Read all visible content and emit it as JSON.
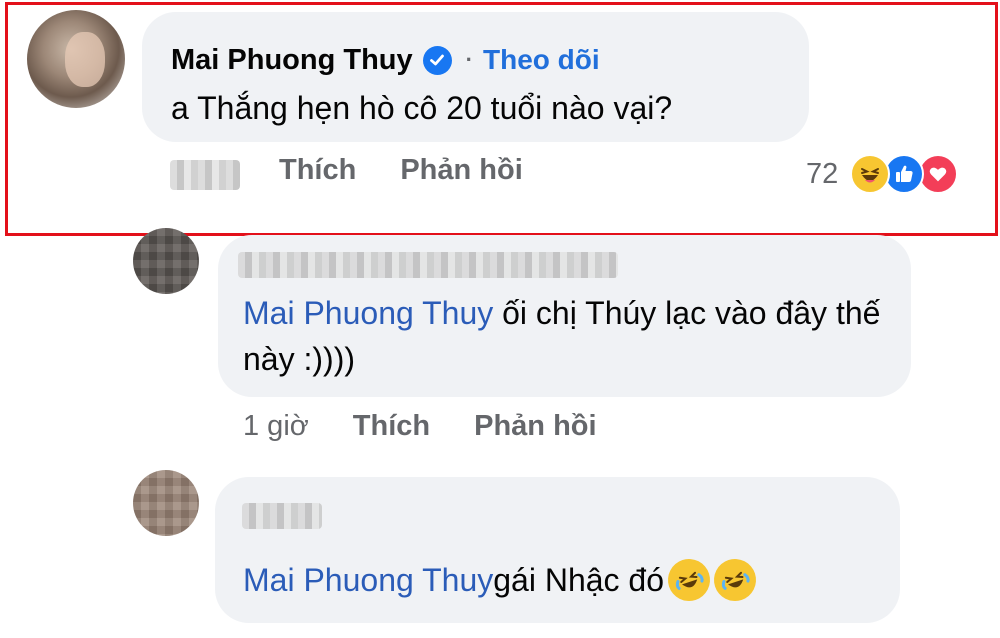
{
  "main_comment": {
    "author": "Mai Phuong Thuy",
    "separator": "·",
    "follow_label": "Theo dõi",
    "text": "a Thắng hẹn hò cô 20 tuổi nào vại?",
    "like_label": "Thích",
    "reply_label": "Phản hồi",
    "reaction_count": "72",
    "reaction_icons": [
      "haha-icon",
      "like-icon",
      "love-icon"
    ],
    "verified_color": "#1877f2"
  },
  "replies": [
    {
      "mention": "Mai Phuong Thuy",
      "text": " ối chị Thúy lạc vào đây thế này :))))",
      "time": "1 giờ",
      "like_label": "Thích",
      "reply_label": "Phản hồi"
    },
    {
      "mention": "Mai Phuong Thuy",
      "text": " gái Nhậc đó",
      "emojis": [
        "rofl-emoji",
        "rofl-emoji"
      ]
    }
  ],
  "colors": {
    "highlight_border": "#e3101a",
    "link_blue": "#2b5cb8",
    "bubble_bg": "#f0f2f5",
    "meta_gray": "#65676b"
  }
}
